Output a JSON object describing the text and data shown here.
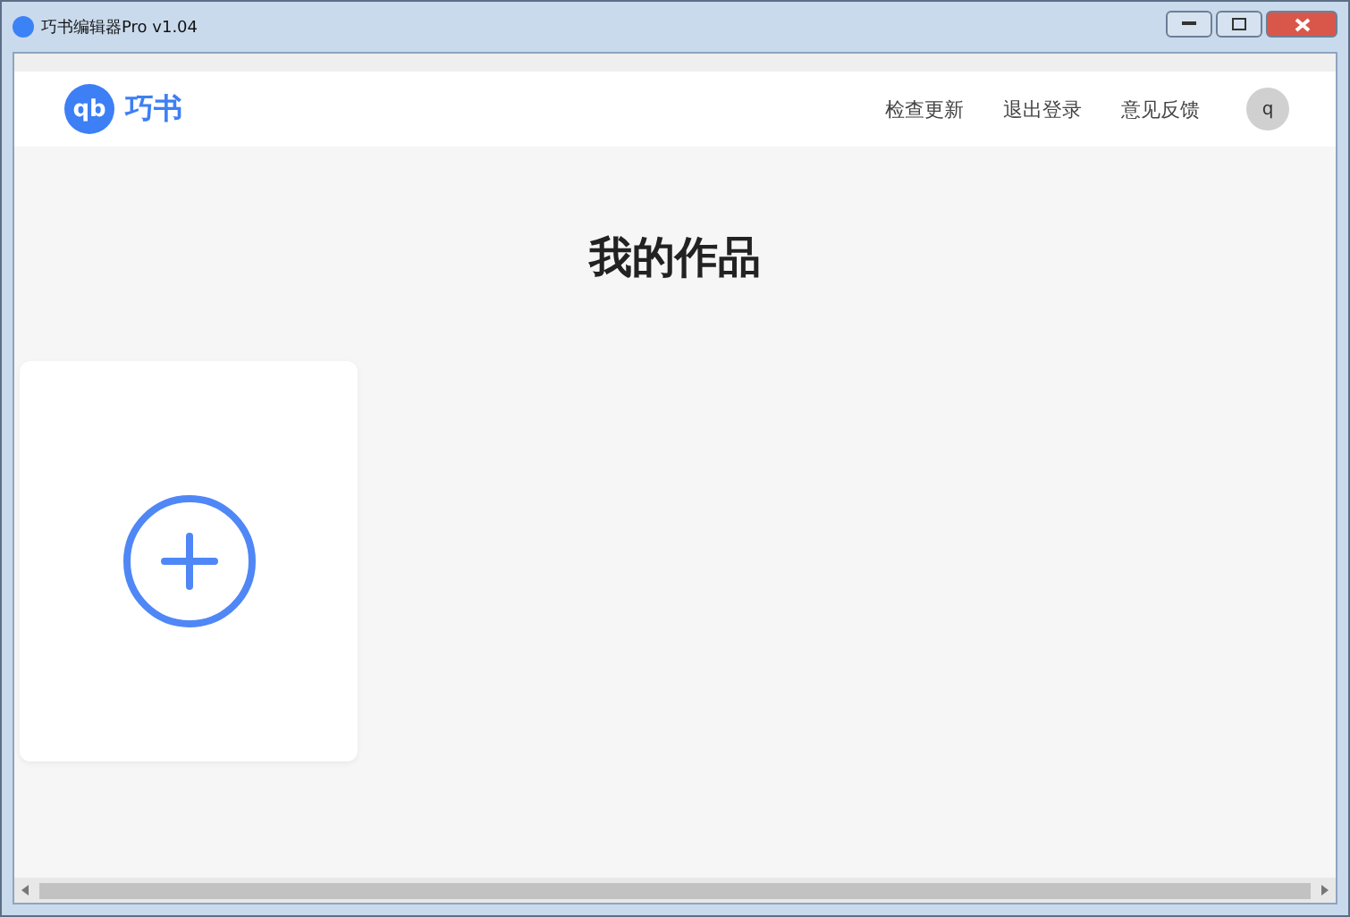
{
  "window": {
    "title": "巧书编辑器Pro v1.04"
  },
  "header": {
    "logo_mark": "qb",
    "logo_text": "巧书",
    "nav": [
      {
        "label": "检查更新"
      },
      {
        "label": "退出登录"
      },
      {
        "label": "意见反馈"
      }
    ],
    "avatar": "q"
  },
  "main": {
    "heading": "我的作品"
  }
}
